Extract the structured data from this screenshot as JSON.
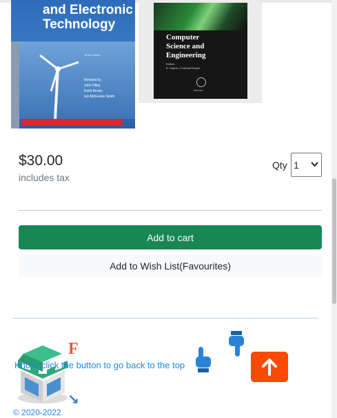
{
  "books": [
    {
      "cover_title": "and Electronic\nTechnology",
      "cover_edition": "Tenth Edition",
      "cover_authors": [
        "Revised by",
        "John Hiley",
        "Keith Brown",
        "Ian McKenzie Smith"
      ]
    },
    {
      "cover_title": "Computer\nScience and\nEngineering",
      "cover_editors_label": "Editors",
      "cover_editors": "R. Rajesh • Prabhat Ranjan",
      "cover_publisher": "Narosa"
    }
  ],
  "product": {
    "price": "$30.00",
    "tax_note": "includes tax",
    "qty_label": "Qty",
    "qty_value": "1"
  },
  "actions": {
    "add_to_cart": "Add to cart",
    "add_to_wishlist": "Add to Wish List(Favourites)"
  },
  "footer": {
    "back_to_top_text": "Know, click the button to go back to the top",
    "copyright": "© 2020-2022",
    "icons": [
      "store-icon",
      "hand-pointing-up-icon",
      "hand-pointing-down-icon",
      "arrow-up-icon"
    ]
  },
  "colors": {
    "cart_button": "#198754",
    "top_button": "#fc4a06",
    "link": "#1e88e5"
  }
}
